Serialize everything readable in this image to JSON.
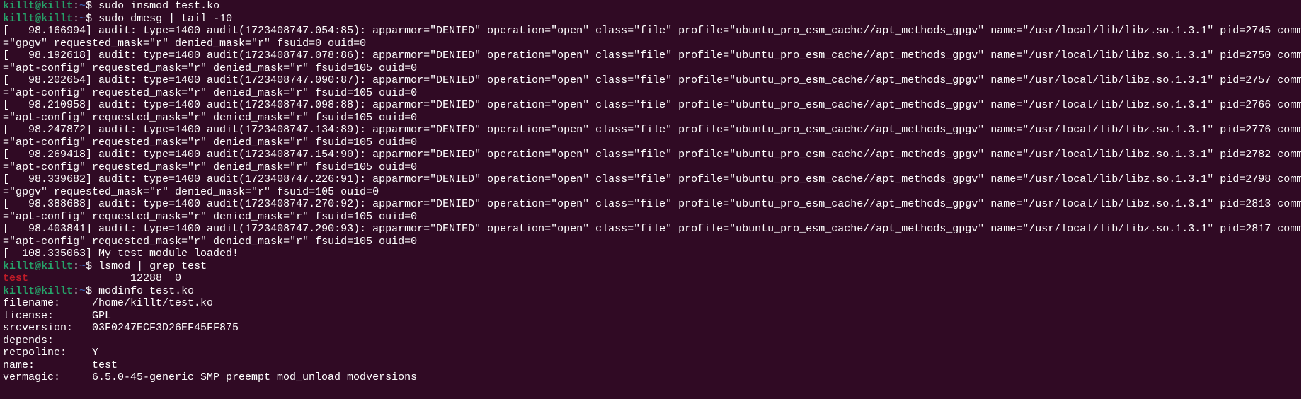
{
  "terminal": {
    "colors": {
      "background": "#300a24",
      "prompt_user": "#26a269",
      "prompt_path": "#3f6fc0",
      "text": "#ffffff",
      "module_name": "#c01c28"
    },
    "prompt": {
      "user_host": "killt@killt",
      "sep": ":",
      "path": "~",
      "symbol": "$ "
    },
    "lines": [
      {
        "kind": "prompt",
        "cmd": "sudo insmod test.ko"
      },
      {
        "kind": "prompt",
        "cmd": "sudo dmesg | tail -10"
      },
      {
        "kind": "text",
        "text": "[   98.166994] audit: type=1400 audit(1723408747.054:85): apparmor=\"DENIED\" operation=\"open\" class=\"file\" profile=\"ubuntu_pro_esm_cache//apt_methods_gpgv\" name=\"/usr/local/lib/libz.so.1.3.1\" pid=2745 comm"
      },
      {
        "kind": "text",
        "text": "=\"gpgv\" requested_mask=\"r\" denied_mask=\"r\" fsuid=0 ouid=0"
      },
      {
        "kind": "text",
        "text": "[   98.192618] audit: type=1400 audit(1723408747.078:86): apparmor=\"DENIED\" operation=\"open\" class=\"file\" profile=\"ubuntu_pro_esm_cache//apt_methods_gpgv\" name=\"/usr/local/lib/libz.so.1.3.1\" pid=2750 comm"
      },
      {
        "kind": "text",
        "text": "=\"apt-config\" requested_mask=\"r\" denied_mask=\"r\" fsuid=105 ouid=0"
      },
      {
        "kind": "text",
        "text": "[   98.202654] audit: type=1400 audit(1723408747.090:87): apparmor=\"DENIED\" operation=\"open\" class=\"file\" profile=\"ubuntu_pro_esm_cache//apt_methods_gpgv\" name=\"/usr/local/lib/libz.so.1.3.1\" pid=2757 comm"
      },
      {
        "kind": "text",
        "text": "=\"apt-config\" requested_mask=\"r\" denied_mask=\"r\" fsuid=105 ouid=0"
      },
      {
        "kind": "text",
        "text": "[   98.210958] audit: type=1400 audit(1723408747.098:88): apparmor=\"DENIED\" operation=\"open\" class=\"file\" profile=\"ubuntu_pro_esm_cache//apt_methods_gpgv\" name=\"/usr/local/lib/libz.so.1.3.1\" pid=2766 comm"
      },
      {
        "kind": "text",
        "text": "=\"apt-config\" requested_mask=\"r\" denied_mask=\"r\" fsuid=105 ouid=0"
      },
      {
        "kind": "text",
        "text": "[   98.247872] audit: type=1400 audit(1723408747.134:89): apparmor=\"DENIED\" operation=\"open\" class=\"file\" profile=\"ubuntu_pro_esm_cache//apt_methods_gpgv\" name=\"/usr/local/lib/libz.so.1.3.1\" pid=2776 comm"
      },
      {
        "kind": "text",
        "text": "=\"apt-config\" requested_mask=\"r\" denied_mask=\"r\" fsuid=105 ouid=0"
      },
      {
        "kind": "text",
        "text": "[   98.269418] audit: type=1400 audit(1723408747.154:90): apparmor=\"DENIED\" operation=\"open\" class=\"file\" profile=\"ubuntu_pro_esm_cache//apt_methods_gpgv\" name=\"/usr/local/lib/libz.so.1.3.1\" pid=2782 comm"
      },
      {
        "kind": "text",
        "text": "=\"apt-config\" requested_mask=\"r\" denied_mask=\"r\" fsuid=105 ouid=0"
      },
      {
        "kind": "text",
        "text": "[   98.339682] audit: type=1400 audit(1723408747.226:91): apparmor=\"DENIED\" operation=\"open\" class=\"file\" profile=\"ubuntu_pro_esm_cache//apt_methods_gpgv\" name=\"/usr/local/lib/libz.so.1.3.1\" pid=2798 comm"
      },
      {
        "kind": "text",
        "text": "=\"gpgv\" requested_mask=\"r\" denied_mask=\"r\" fsuid=105 ouid=0"
      },
      {
        "kind": "text",
        "text": "[   98.388688] audit: type=1400 audit(1723408747.270:92): apparmor=\"DENIED\" operation=\"open\" class=\"file\" profile=\"ubuntu_pro_esm_cache//apt_methods_gpgv\" name=\"/usr/local/lib/libz.so.1.3.1\" pid=2813 comm"
      },
      {
        "kind": "text",
        "text": "=\"apt-config\" requested_mask=\"r\" denied_mask=\"r\" fsuid=105 ouid=0"
      },
      {
        "kind": "text",
        "text": "[   98.403841] audit: type=1400 audit(1723408747.290:93): apparmor=\"DENIED\" operation=\"open\" class=\"file\" profile=\"ubuntu_pro_esm_cache//apt_methods_gpgv\" name=\"/usr/local/lib/libz.so.1.3.1\" pid=2817 comm"
      },
      {
        "kind": "text",
        "text": "=\"apt-config\" requested_mask=\"r\" denied_mask=\"r\" fsuid=105 ouid=0"
      },
      {
        "kind": "text",
        "text": "[  108.335063] My test module loaded!"
      },
      {
        "kind": "prompt",
        "cmd": "lsmod | grep test"
      },
      {
        "kind": "lsmod",
        "name": "test",
        "rest": "                12288  0"
      },
      {
        "kind": "prompt",
        "cmd": "modinfo test.ko"
      },
      {
        "kind": "field",
        "key": "filename:",
        "value": "/home/killt/test.ko"
      },
      {
        "kind": "field",
        "key": "license:",
        "value": "GPL"
      },
      {
        "kind": "field",
        "key": "srcversion:",
        "value": "03F0247ECF3D26EF45FF875"
      },
      {
        "kind": "field",
        "key": "depends:",
        "value": ""
      },
      {
        "kind": "field",
        "key": "retpoline:",
        "value": "Y"
      },
      {
        "kind": "field",
        "key": "name:",
        "value": "test"
      },
      {
        "kind": "field",
        "key": "vermagic:",
        "value": "6.5.0-45-generic SMP preempt mod_unload modversions"
      }
    ]
  }
}
